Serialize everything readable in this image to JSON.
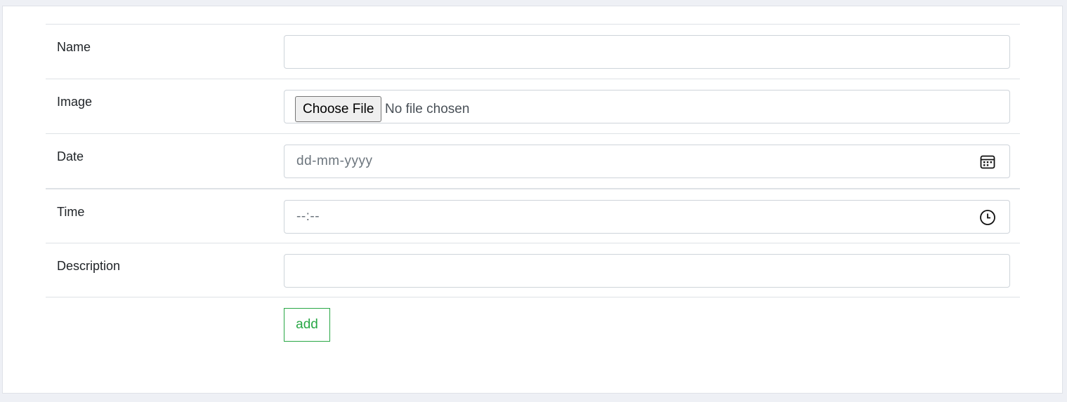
{
  "form": {
    "rows": [
      {
        "label": "Name",
        "value": ""
      },
      {
        "label": "Image",
        "button_label": "Choose File",
        "status": "No file chosen"
      },
      {
        "label": "Date",
        "placeholder": "dd-mm-yyyy",
        "icon": "calendar-icon"
      },
      {
        "label": "Time",
        "placeholder": "--:--",
        "icon": "clock-icon"
      },
      {
        "label": "Description",
        "value": ""
      }
    ],
    "submit_label": "add"
  },
  "colors": {
    "page_background": "#eef0f5",
    "border": "#dee2e6",
    "input_border": "#ced4da",
    "success": "#28a745"
  }
}
